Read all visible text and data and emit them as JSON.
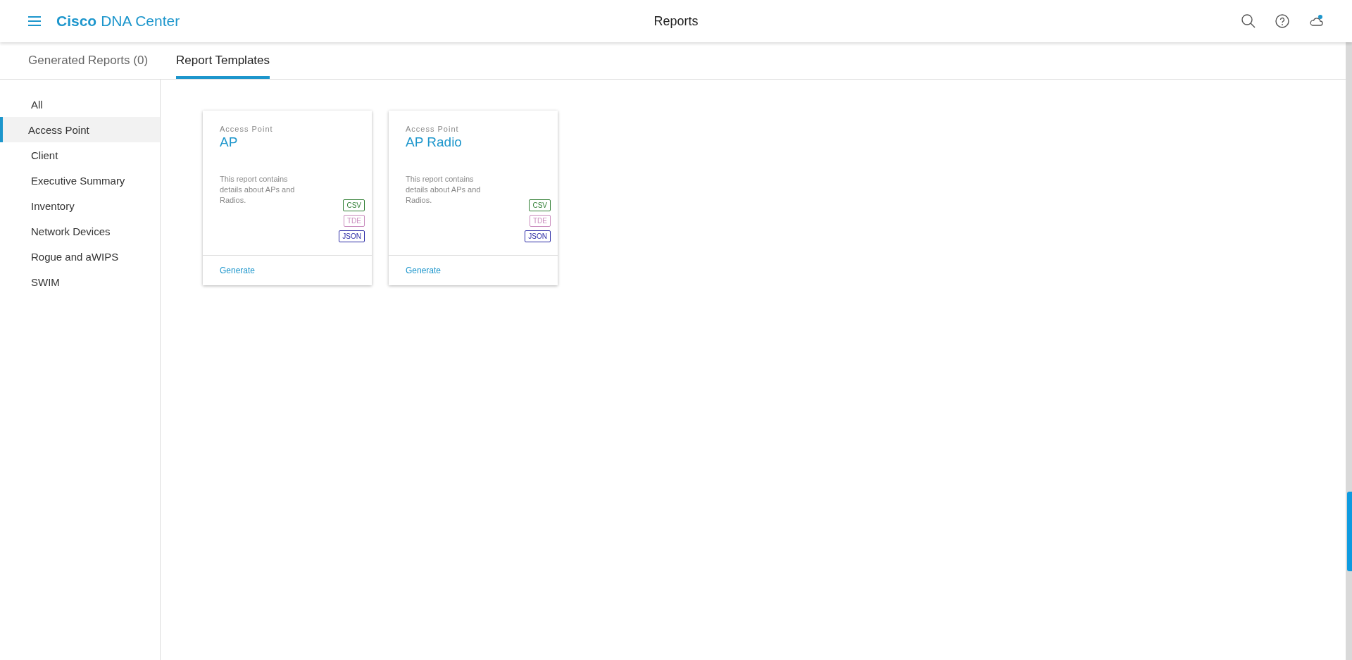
{
  "header": {
    "brand_bold": "Cisco",
    "brand_rest": "DNA Center",
    "title": "Reports"
  },
  "tabs": [
    {
      "label": "Generated Reports (0)",
      "selected": false
    },
    {
      "label": "Report Templates",
      "selected": true
    }
  ],
  "sidebar": {
    "items": [
      {
        "label": "All",
        "selected": false
      },
      {
        "label": "Access Point",
        "selected": true
      },
      {
        "label": "Client",
        "selected": false
      },
      {
        "label": "Executive Summary",
        "selected": false
      },
      {
        "label": "Inventory",
        "selected": false
      },
      {
        "label": "Network Devices",
        "selected": false
      },
      {
        "label": "Rogue and aWIPS",
        "selected": false
      },
      {
        "label": "SWIM",
        "selected": false
      }
    ]
  },
  "cards": [
    {
      "category": "Access Point",
      "title": "AP",
      "description": "This report contains details about APs and Radios.",
      "formats": [
        {
          "label": "CSV",
          "color": "#2e7d32"
        },
        {
          "label": "TDE",
          "color": "#c98bbd"
        },
        {
          "label": "JSON",
          "color": "#2b2ba6"
        }
      ],
      "action": "Generate"
    },
    {
      "category": "Access Point",
      "title": "AP Radio",
      "description": "This report contains details about APs and Radios.",
      "formats": [
        {
          "label": "CSV",
          "color": "#2e7d32"
        },
        {
          "label": "TDE",
          "color": "#c98bbd"
        },
        {
          "label": "JSON",
          "color": "#2b2ba6"
        }
      ],
      "action": "Generate"
    }
  ]
}
